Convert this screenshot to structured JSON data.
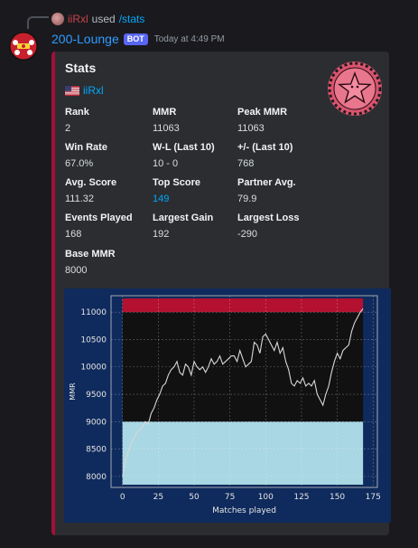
{
  "reply": {
    "username": "iiRxl",
    "used_text": "used",
    "command": "/stats"
  },
  "message": {
    "bot_name": "200-Lounge",
    "badge": "BOT",
    "timestamp": "Today at 4:49 PM"
  },
  "embed": {
    "accent_color": "#a30f3a",
    "title": "Stats",
    "player": {
      "flag": "us-flag-icon",
      "name": "iiRxl"
    },
    "fields": [
      {
        "name": "Rank",
        "value": "2"
      },
      {
        "name": "MMR",
        "value": "11063"
      },
      {
        "name": "Peak MMR",
        "value": "11063"
      },
      {
        "name": "Win Rate",
        "value": "67.0%"
      },
      {
        "name": "W-L (Last 10)",
        "value": "10 - 0"
      },
      {
        "name": "+/- (Last 10)",
        "value": "768"
      },
      {
        "name": "Avg. Score",
        "value": "111.32"
      },
      {
        "name": "Top Score",
        "value": "149"
      },
      {
        "name": "Partner Avg.",
        "value": "79.9"
      },
      {
        "name": "Events Played",
        "value": "168"
      },
      {
        "name": "Largest Gain",
        "value": "192"
      },
      {
        "name": "Largest Loss",
        "value": "-290"
      },
      {
        "name": "Base MMR",
        "value": "8000"
      }
    ]
  },
  "chart_data": {
    "type": "line",
    "xlabel": "Matches played",
    "ylabel": "MMR",
    "xlim": [
      -8,
      178
    ],
    "ylim": [
      7800,
      11300
    ],
    "xticks": [
      0,
      25,
      50,
      75,
      100,
      125,
      150,
      175
    ],
    "yticks": [
      8000,
      8500,
      9000,
      9500,
      10000,
      10500,
      11000
    ],
    "grid": true,
    "rank_bands": [
      {
        "from": 7850,
        "to": 9000,
        "color": "#a9d7e3"
      },
      {
        "from": 9000,
        "to": 11000,
        "color": "#111111"
      },
      {
        "from": 11000,
        "to": 11250,
        "color": "#b3112f"
      }
    ],
    "series": [
      {
        "x": [
          0,
          2,
          4,
          6,
          8,
          10,
          12,
          14,
          16,
          18,
          20,
          22,
          24,
          26,
          28,
          30,
          32,
          34,
          36,
          38,
          40,
          42,
          44,
          46,
          48,
          50,
          52,
          54,
          56,
          58,
          60,
          62,
          64,
          66,
          68,
          70,
          72,
          74,
          76,
          78,
          80,
          82,
          84,
          86,
          88,
          90,
          92,
          94,
          96,
          98,
          100,
          102,
          104,
          106,
          108,
          110,
          112,
          114,
          116,
          118,
          120,
          122,
          124,
          126,
          128,
          130,
          132,
          134,
          136,
          138,
          140,
          142,
          144,
          146,
          148,
          150,
          152,
          154,
          156,
          158,
          160,
          162,
          164,
          166,
          168
        ],
        "y": [
          8000,
          8300,
          8450,
          8600,
          8700,
          8800,
          8850,
          8900,
          9000,
          8950,
          9150,
          9250,
          9400,
          9500,
          9650,
          9700,
          9850,
          9950,
          10000,
          10100,
          9900,
          9850,
          10050,
          10000,
          9850,
          10100,
          10000,
          9950,
          10000,
          9900,
          10000,
          10150,
          10050,
          10100,
          10200,
          10050,
          10100,
          10150,
          10200,
          10200,
          10100,
          10300,
          10150,
          10000,
          10050,
          10100,
          10450,
          10400,
          10250,
          10550,
          10600,
          10500,
          10400,
          10300,
          10450,
          10250,
          10350,
          10100,
          9950,
          9700,
          9650,
          9750,
          9700,
          9800,
          9650,
          9700,
          9650,
          9750,
          9500,
          9400,
          9300,
          9500,
          9650,
          9900,
          10100,
          10250,
          10150,
          10300,
          10350,
          10400,
          10650,
          10800,
          10900,
          11000,
          11063
        ]
      }
    ]
  }
}
